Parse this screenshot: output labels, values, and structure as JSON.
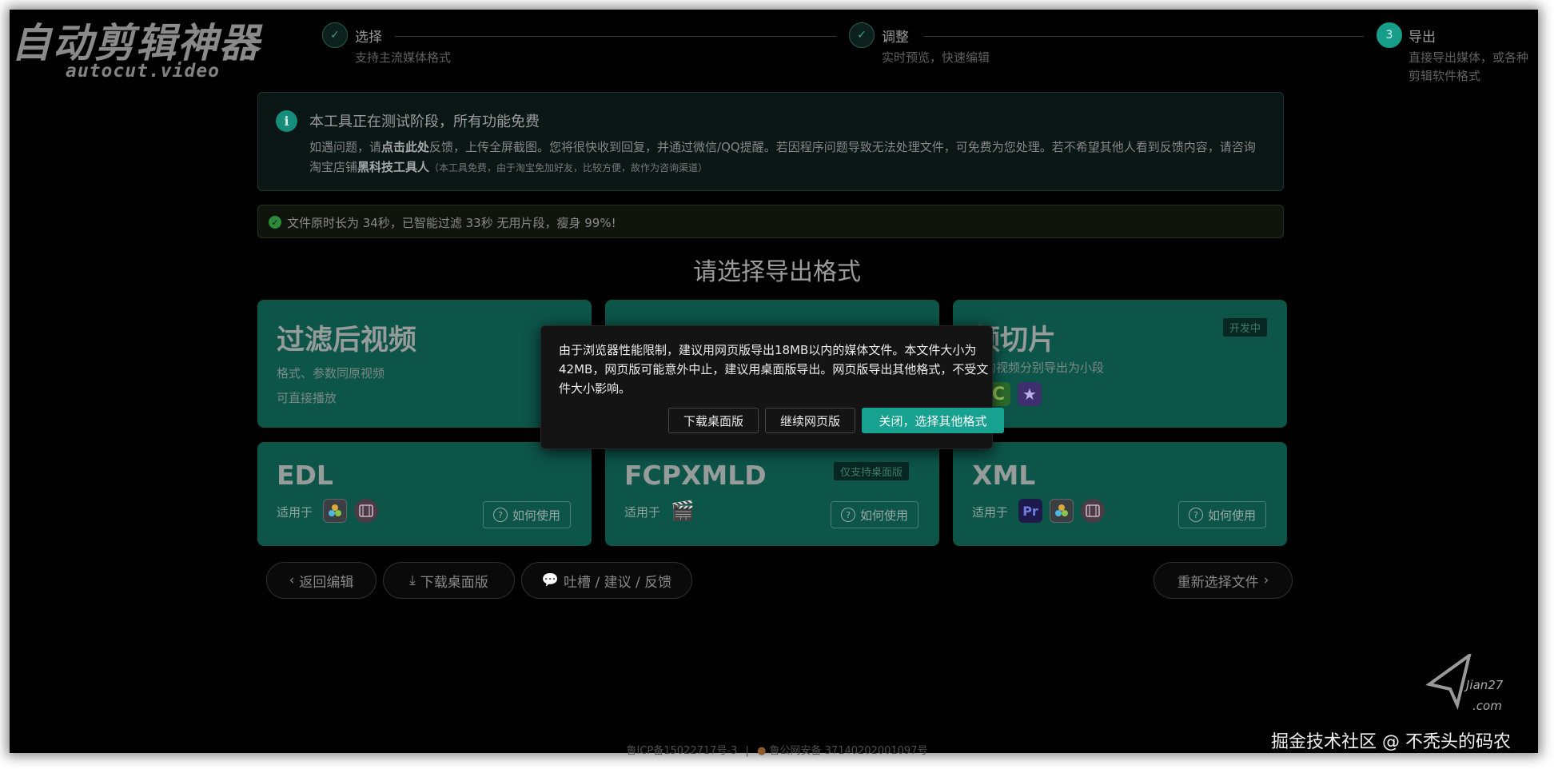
{
  "brand": {
    "title": "自动剪辑神器",
    "subtitle": "autocut.video"
  },
  "steps": [
    {
      "number": "✓",
      "title": "选择",
      "desc": "支持主流媒体格式"
    },
    {
      "number": "✓",
      "title": "调整",
      "desc": "实时预览，快速编辑"
    },
    {
      "number": "3",
      "title": "导出",
      "desc_line1": "直接导出媒体，或各种",
      "desc_line2": "剪辑软件格式"
    }
  ],
  "info": {
    "title": "本工具正在测试阶段，所有功能免费",
    "p1": "如遇问题，请",
    "link": "点击此处",
    "p2": "反馈，上传全屏截图。您将很快收到回复，并通过微信/QQ提醒。若因程序问题导致无法处理文件，可免费为您处理。若不希望其他人看到反馈内容，请咨询淘宝店铺",
    "shop": "黑科技工具人",
    "note": "（本工具免费，由于淘宝免加好友，比较方便，故作为咨询渠道）"
  },
  "success": {
    "text": "文件原时长为 34秒，已智能过滤 33秒 无用片段，瘦身 99%!"
  },
  "heading": "请选择导出格式",
  "cards": {
    "video": {
      "title": "过滤后视频",
      "sub1": "格式、参数同原视频",
      "sub2": "可直接播放"
    },
    "clips": {
      "title": "频切片",
      "sub": "后的视频分别导出为小段",
      "badge": "开发中"
    },
    "edl": {
      "title": "EDL",
      "apps_label": "适用于",
      "howto": "如何使用"
    },
    "fcp": {
      "title": "FCPXMLD",
      "apps_label": "适用于",
      "badge": "仅支持桌面版",
      "howto": "如何使用"
    },
    "xml": {
      "title": "XML",
      "apps_label": "适用于",
      "howto": "如何使用"
    }
  },
  "app_icons": {
    "davinci": "davinci-resolve-icon",
    "film": "film-reel-icon",
    "premiere": "Pr",
    "fcp": "🎬",
    "camtasia": "C",
    "imovie": "★"
  },
  "bottom_bar": {
    "back": "返回编辑",
    "download": "下载桌面版",
    "feedback": "吐槽 / 建议 / 反馈",
    "reselect": "重新选择文件"
  },
  "dialog": {
    "message": "由于浏览器性能限制，建议用网页版导出18MB以内的媒体文件。本文件大小为42MB，网页版可能意外中止，建议用桌面版导出。网页版导出其他格式，不受文件大小影响。",
    "btn_download": "下载桌面版",
    "btn_continue": "继续网页版",
    "btn_close": "关闭，选择其他格式"
  },
  "footer": {
    "icp": "鲁ICP备15022717号-3",
    "separator": "|",
    "police": "鲁公网安备 37140202001097号"
  },
  "watermark": {
    "logo_top": "Jian27",
    "logo_bottom": ".com",
    "text": "掘金技术社区 @ 不秃头的码农"
  },
  "colors": {
    "accent": "#17a190",
    "card_bg": "#0d5449",
    "backdrop": "#000000"
  }
}
